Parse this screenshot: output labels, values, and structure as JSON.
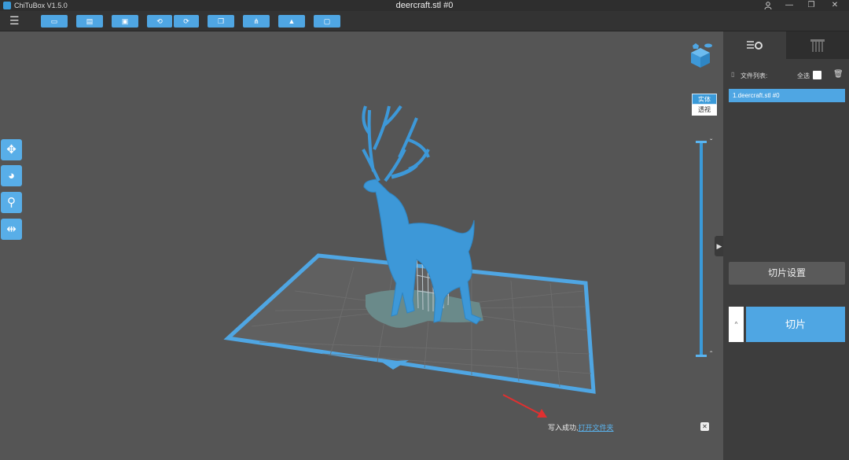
{
  "window": {
    "app_title": "ChiTuBox V1.5.0",
    "doc_title": "deercraft.stl #0",
    "user_icon": "user-icon",
    "minimize": "—",
    "restore": "❐",
    "close": "✕"
  },
  "toolbar": {
    "menu": "☰",
    "buttons": [
      {
        "icon": "open-file-icon",
        "glyph": "▭"
      },
      {
        "icon": "save-icon",
        "glyph": "▤"
      },
      {
        "icon": "import-icon",
        "glyph": "▣"
      },
      {
        "icon": "undo-icon",
        "glyph": "⟲"
      },
      {
        "icon": "redo-icon",
        "glyph": "⟳"
      },
      {
        "icon": "copy-icon",
        "glyph": "❐"
      },
      {
        "icon": "support-icon",
        "glyph": "⋔"
      },
      {
        "icon": "hollow-icon",
        "glyph": "▲"
      },
      {
        "icon": "plate-icon",
        "glyph": "▢"
      }
    ]
  },
  "side_tools": [
    {
      "icon": "move-icon",
      "glyph": "✥"
    },
    {
      "icon": "rotate-icon",
      "glyph": "◕"
    },
    {
      "icon": "scale-icon",
      "glyph": "⚲"
    },
    {
      "icon": "mirror-icon",
      "glyph": "⇹"
    }
  ],
  "view_modes": {
    "solid": "实体",
    "transparent": "透视"
  },
  "layer_slider": {
    "up": "ˇ",
    "down": "ˆ"
  },
  "status": {
    "message": "写入成功,",
    "link": "打开文件夹",
    "close": "✕"
  },
  "panel": {
    "tab1_icon": "settings-list-icon",
    "tab2_icon": "support-pillar-icon",
    "filelist_label": "文件列表:",
    "select_all": "全选",
    "delete_icon": "trash-icon",
    "files": [
      "1.deercraft.stl #0"
    ],
    "slice_settings": "切片设置",
    "slice_up": "^",
    "slice": "切片"
  },
  "colors": {
    "accent": "#4fa6e3",
    "model": "#3d98d8",
    "viewport": "#555555",
    "panel": "#3d3d3d"
  }
}
